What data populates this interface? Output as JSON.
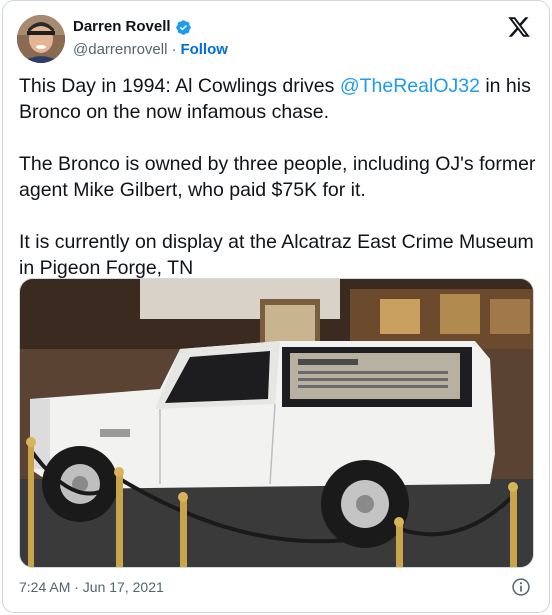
{
  "author": {
    "display_name": "Darren Rovell",
    "handle": "@darrenrovell",
    "separator": "·",
    "follow_label": "Follow"
  },
  "tweet": {
    "line1_before": "This Day in 1994: Al Cowlings drives ",
    "mention": "@TheRealOJ32",
    "line1_after": " in his Bronco on the now infamous chase.",
    "paragraph2": "The Bronco is owned by three people, including OJ's former agent Mike Gilbert, who paid $75K for it.",
    "paragraph3": "It is currently on display at the Alcatraz East Crime Museum in Pigeon Forge, TN"
  },
  "timestamp": "7:24 AM · Jun 17, 2021",
  "colors": {
    "link": "#1d9bf0",
    "follow": "#006fd6",
    "verified": "#1d9bf0",
    "text": "#0f1419",
    "secondary": "#536471"
  },
  "icons": [
    "verified-badge-icon",
    "x-logo-icon",
    "info-icon"
  ]
}
